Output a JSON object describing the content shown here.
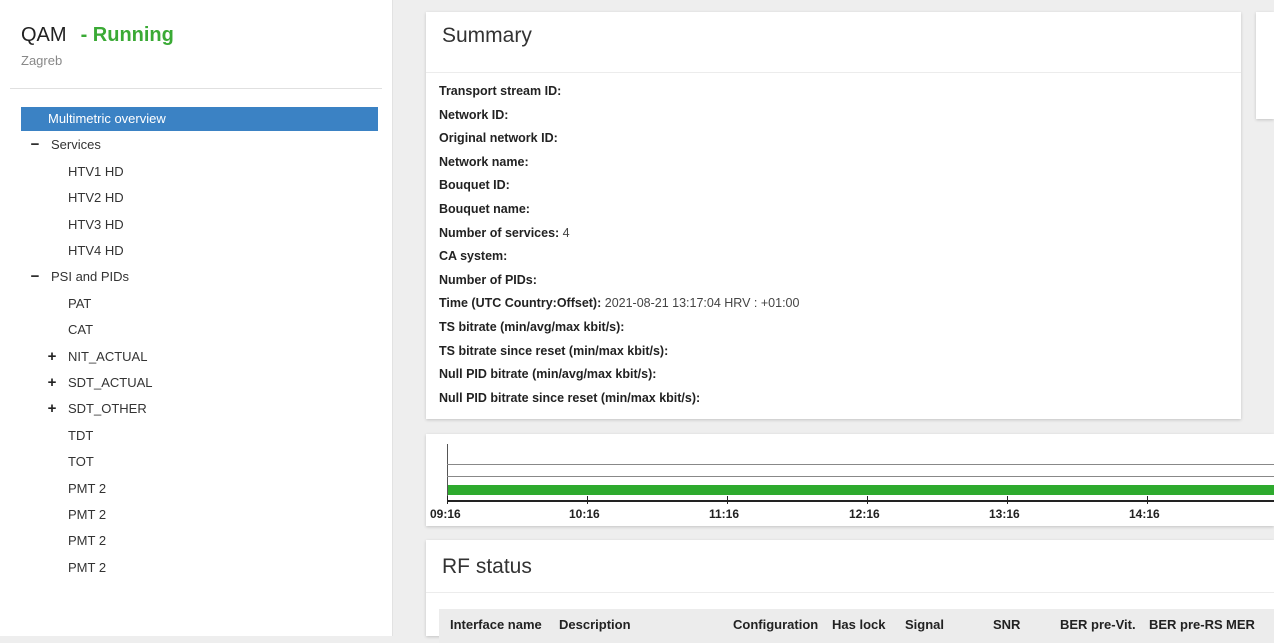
{
  "sidebar": {
    "title": "QAM",
    "status": "- Running",
    "subtitle": "Zagreb",
    "items": [
      {
        "label": "Multimetric overview",
        "toggle": ""
      },
      {
        "label": "Services",
        "toggle": "−"
      },
      {
        "label": "HTV1 HD",
        "toggle": ""
      },
      {
        "label": "HTV2 HD",
        "toggle": ""
      },
      {
        "label": "HTV3 HD",
        "toggle": ""
      },
      {
        "label": "HTV4 HD",
        "toggle": ""
      },
      {
        "label": "PSI and PIDs",
        "toggle": "−"
      },
      {
        "label": "PAT",
        "toggle": ""
      },
      {
        "label": "CAT",
        "toggle": ""
      },
      {
        "label": "NIT_ACTUAL",
        "toggle": "+"
      },
      {
        "label": "SDT_ACTUAL",
        "toggle": "+"
      },
      {
        "label": "SDT_OTHER",
        "toggle": "+"
      },
      {
        "label": "TDT",
        "toggle": ""
      },
      {
        "label": "TOT",
        "toggle": ""
      },
      {
        "label": "PMT 2",
        "toggle": ""
      },
      {
        "label": "PMT 2",
        "toggle": ""
      },
      {
        "label": "PMT 2",
        "toggle": ""
      },
      {
        "label": "PMT 2",
        "toggle": ""
      }
    ]
  },
  "summary": {
    "title": "Summary",
    "rows": [
      {
        "label": "Transport stream ID:",
        "value": ""
      },
      {
        "label": "Network ID:",
        "value": ""
      },
      {
        "label": "Original network ID:",
        "value": ""
      },
      {
        "label": "Network name:",
        "value": ""
      },
      {
        "label": "Bouquet ID:",
        "value": ""
      },
      {
        "label": "Bouquet name:",
        "value": ""
      },
      {
        "label": "Number of services:",
        "value": " 4"
      },
      {
        "label": "CA system:",
        "value": ""
      },
      {
        "label": "Number of PIDs:",
        "value": ""
      },
      {
        "label": "Time (UTC Country:Offset):",
        "value": " 2021-08-21 13:17:04 HRV : +01:00"
      },
      {
        "label": "TS bitrate (min/avg/max kbit/s):",
        "value": ""
      },
      {
        "label": "TS bitrate since reset (min/max kbit/s):",
        "value": ""
      },
      {
        "label": "Null PID bitrate (min/avg/max kbit/s):",
        "value": ""
      },
      {
        "label": "Null PID bitrate since reset (min/max kbit/s):",
        "value": ""
      }
    ]
  },
  "timeline": {
    "labels": [
      "09:16",
      "10:16",
      "11:16",
      "12:16",
      "13:16",
      "14:16"
    ],
    "bar_color": "#2eaa2e"
  },
  "rf_status": {
    "title": "RF status",
    "columns": [
      "Interface name",
      "Description",
      "Configuration",
      "Has lock",
      "Signal",
      "SNR",
      "BER pre-Vit.",
      "BER pre-RS",
      "MER"
    ]
  },
  "colors": {
    "accent": "#3b82c4",
    "running": "#3aaa35"
  }
}
